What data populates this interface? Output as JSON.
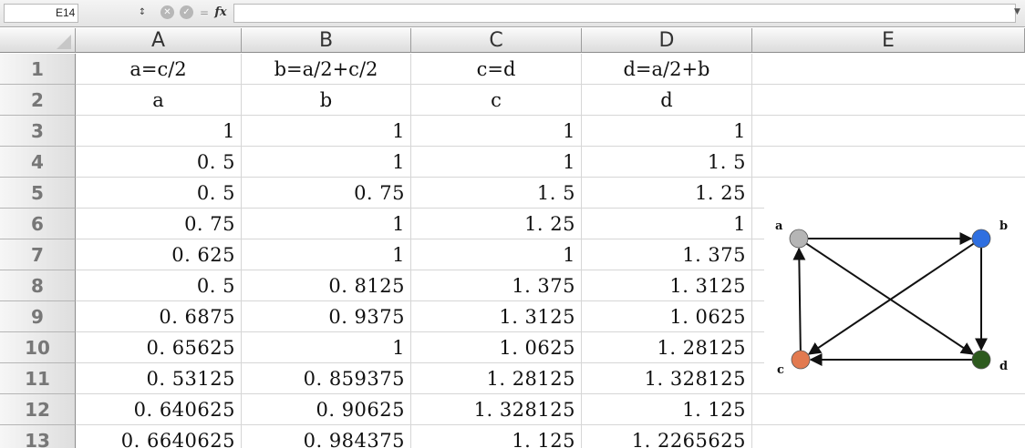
{
  "formula_bar": {
    "name_box": "E14",
    "stepper_icon": "updown-arrows-icon",
    "cancel_icon": "x-icon",
    "confirm_icon": "check-icon",
    "equals": "=",
    "fx_label": "fx",
    "formula": ""
  },
  "columns": [
    "A",
    "B",
    "C",
    "D",
    "E"
  ],
  "rows": [
    {
      "num": "1",
      "cells": [
        "a=c/2",
        "b=a/2+c/2",
        "c=d",
        "d=a/2+b"
      ]
    },
    {
      "num": "2",
      "cells": [
        "a",
        "b",
        "c",
        "d"
      ]
    },
    {
      "num": "3",
      "cells": [
        "1",
        "1",
        "1",
        "1"
      ]
    },
    {
      "num": "4",
      "cells": [
        "0. 5",
        "1",
        "1",
        "1. 5"
      ]
    },
    {
      "num": "5",
      "cells": [
        "0. 5",
        "0. 75",
        "1. 5",
        "1. 25"
      ]
    },
    {
      "num": "6",
      "cells": [
        "0. 75",
        "1",
        "1. 25",
        "1"
      ]
    },
    {
      "num": "7",
      "cells": [
        "0. 625",
        "1",
        "1",
        "1. 375"
      ]
    },
    {
      "num": "8",
      "cells": [
        "0. 5",
        "0. 8125",
        "1. 375",
        "1. 3125"
      ]
    },
    {
      "num": "9",
      "cells": [
        "0. 6875",
        "0. 9375",
        "1. 3125",
        "1. 0625"
      ]
    },
    {
      "num": "10",
      "cells": [
        "0. 65625",
        "1",
        "1. 0625",
        "1. 28125"
      ]
    },
    {
      "num": "11",
      "cells": [
        "0. 53125",
        "0. 859375",
        "1. 28125",
        "1. 328125"
      ]
    },
    {
      "num": "12",
      "cells": [
        "0. 640625",
        "0. 90625",
        "1. 328125",
        "1. 125"
      ]
    },
    {
      "num": "13",
      "cells": [
        "0. 6640625",
        "0. 984375",
        "1. 125",
        "1. 2265625"
      ]
    }
  ],
  "diagram": {
    "nodes": [
      {
        "id": "a",
        "label": "a",
        "color": "#b5b5b5"
      },
      {
        "id": "b",
        "label": "b",
        "color": "#2f6fe0"
      },
      {
        "id": "c",
        "label": "c",
        "color": "#e27a50"
      },
      {
        "id": "d",
        "label": "d",
        "color": "#2d5a1e"
      }
    ]
  }
}
